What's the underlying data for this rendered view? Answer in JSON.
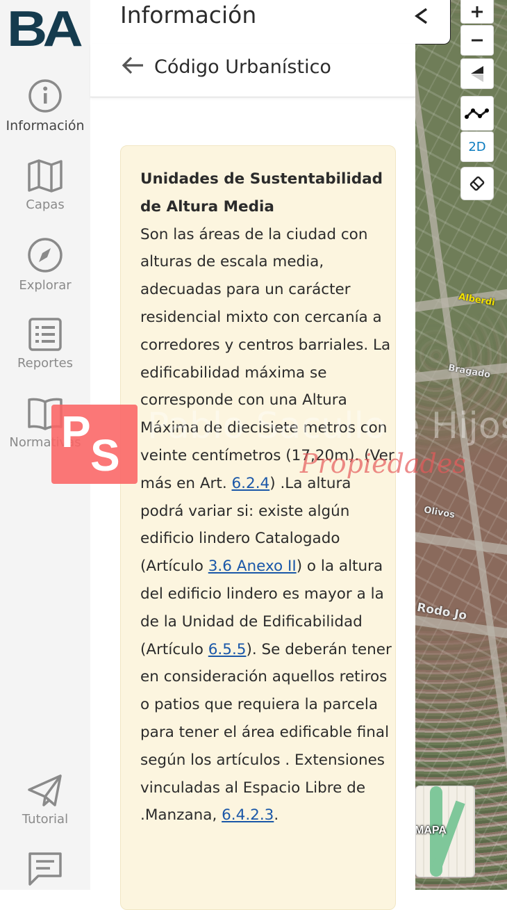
{
  "sidebar": {
    "logo": "BA",
    "items": [
      {
        "label": "Información"
      },
      {
        "label": "Capas"
      },
      {
        "label": "Explorar"
      },
      {
        "label": "Reportes"
      },
      {
        "label": "Normativas"
      },
      {
        "label": "Tutorial"
      }
    ]
  },
  "panel": {
    "title": "Información",
    "subtitle": "Código Urbanístico",
    "card": {
      "heading": "Unidades de Sustentabilidad de Altura Media",
      "p1": "Son las áreas de la ciudad con alturas de escala media, adecuadas para un carácter residencial mixto con cercanía a corredores y centros barriales. La edificabilidad máxima se corresponde con una Altura Máxima de diecisiete metros con veinte centímetros (17,20m). (Ver más en Art. ",
      "link1": "6.2.4",
      "p2": ") .La altura podrá variar si: existe algún edificio lindero Catalogado (Artículo ",
      "link2": "3.6 Anexo II",
      "p3": ") o la altura del edificio lindero es mayor a la de la Unidad de Edificabilidad (Artículo ",
      "link3": "6.5.5",
      "p4": "). Se deberán tener en consideración aquellos retiros o patios que requiera la parcela para tener el área edificable final según los artículos . Extensiones vinculadas al Espacio Libre de .Manzana, ",
      "link4": "6.4.2.3",
      "p5": "."
    }
  },
  "map": {
    "controls": {
      "mode_label": "2D"
    },
    "streets": [
      "Alberdi",
      "Bragado",
      "Olivos",
      "Rodo Jo"
    ],
    "minimap_label": "MAPA"
  },
  "watermark": {
    "badge_p": "P",
    "badge_s": "S",
    "name": "Pablo Sacullo e Hijos",
    "sub": "Propiedades"
  },
  "colors": {
    "logo": "#153b4e",
    "card_bg": "#fcf5df",
    "link": "#1a57a8",
    "ctrl_2d": "#0a7bbf"
  }
}
